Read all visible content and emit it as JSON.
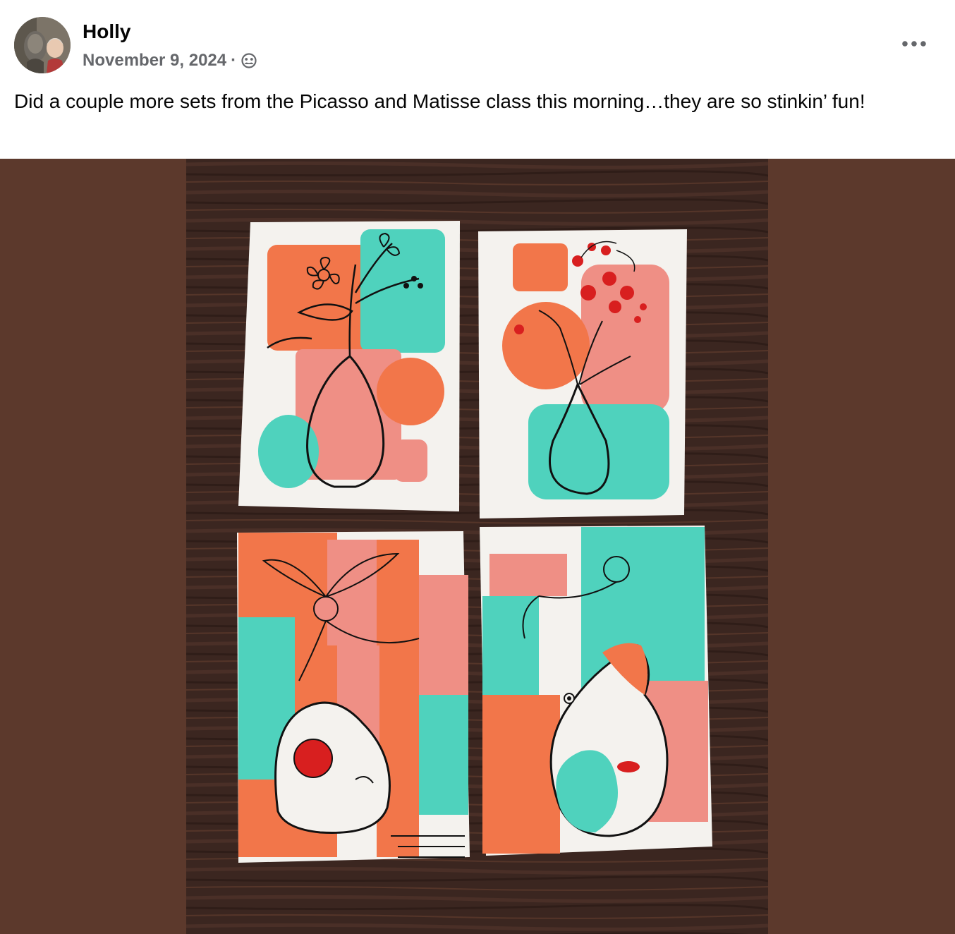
{
  "post": {
    "author": "Holly",
    "date": "November 9, 2024",
    "separator": "·",
    "privacy_icon": "friends-globe-icon",
    "more_icon": "more-options-icon",
    "text": "Did a couple more sets from the Picasso and Matisse class this morning…they are so stinkin’ fun!"
  },
  "colors": {
    "media_background": "#5c392c",
    "author_text": "#050505",
    "meta_text": "#65676b",
    "orange": "#f2764a",
    "coral_pink": "#ef8f85",
    "teal": "#4fd2bd",
    "red": "#d81f1f",
    "paper": "#f4f2ee"
  }
}
